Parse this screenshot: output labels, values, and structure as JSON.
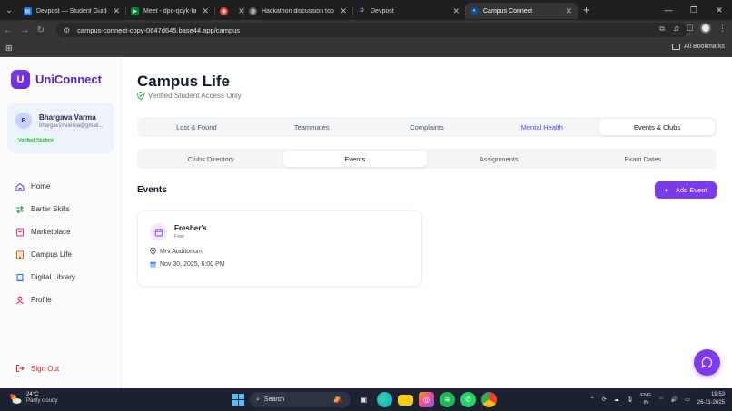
{
  "browser": {
    "tabs": [
      {
        "title": "Devpost — Student Guide for ",
        "fav_color": "#1a73e8",
        "fav_glyph": "▤",
        "active": false
      },
      {
        "title": "Meet - dpo-qcyk-fah",
        "fav_color": "#00832d",
        "fav_glyph": "▶",
        "active": false
      },
      {
        "title": "",
        "fav_color": "#ea4335",
        "fav_glyph": "◉",
        "active": false
      },
      {
        "title": "Hackathon discussion topics",
        "fav_color": "#9aa0a6",
        "fav_glyph": "◍",
        "active": false
      },
      {
        "title": "Devpost",
        "fav_color": "#1f1f1f",
        "fav_glyph": "D",
        "active": false
      },
      {
        "title": "Campus Connect",
        "fav_color": "#0b4f8a",
        "fav_glyph": "◐",
        "active": true
      }
    ],
    "url": "campus-connect-copy-0647d645.base44.app/campus",
    "all_bookmarks": "All Bookmarks"
  },
  "sidebar": {
    "logo_letter": "U",
    "app_name": "UniConnect",
    "user": {
      "initial": "B",
      "name": "Bhargava Varma",
      "email": "bhargav24varma@gmail...",
      "badge": "Verified Student"
    },
    "nav": [
      {
        "label": "Home",
        "icon": "home-icon",
        "color": "#4f46e5"
      },
      {
        "label": "Barter Skills",
        "icon": "swap-icon",
        "color": "#16a34a"
      },
      {
        "label": "Marketplace",
        "icon": "bag-icon",
        "color": "#db2777"
      },
      {
        "label": "Campus Life",
        "icon": "building-icon",
        "color": "#ea580c"
      },
      {
        "label": "Digital Library",
        "icon": "book-icon",
        "color": "#2563eb"
      },
      {
        "label": "Profile",
        "icon": "user-icon",
        "color": "#e11d48"
      }
    ],
    "sign_out": "Sign Out"
  },
  "main": {
    "title": "Campus Life",
    "subtitle": "Verified Student Access Only",
    "primary_tabs": [
      "Lost & Found",
      "Teammates",
      "Complaints",
      "Mental Health",
      "Events & Clubs"
    ],
    "primary_active": 4,
    "primary_highlight": 3,
    "secondary_tabs": [
      "Clubs Directory",
      "Events",
      "Assignments",
      "Exam Dates"
    ],
    "secondary_active": 1,
    "section_title": "Events",
    "add_button": "Add Event",
    "events": [
      {
        "name": "Fresher's",
        "category": "Fest",
        "location": "Mrv Auditorium",
        "datetime": "Nov 30, 2025, 6:00 PM"
      }
    ]
  },
  "taskbar": {
    "weather_temp": "24°C",
    "weather_desc": "Partly cloudy",
    "search": "Search",
    "lang_top": "ENG",
    "lang_bottom": "IN",
    "time": "19:53",
    "date": "26-11-2025"
  },
  "colors": {
    "accent": "#7c3aed",
    "brand_text": "#5b21b6",
    "verified": "#15803d"
  }
}
